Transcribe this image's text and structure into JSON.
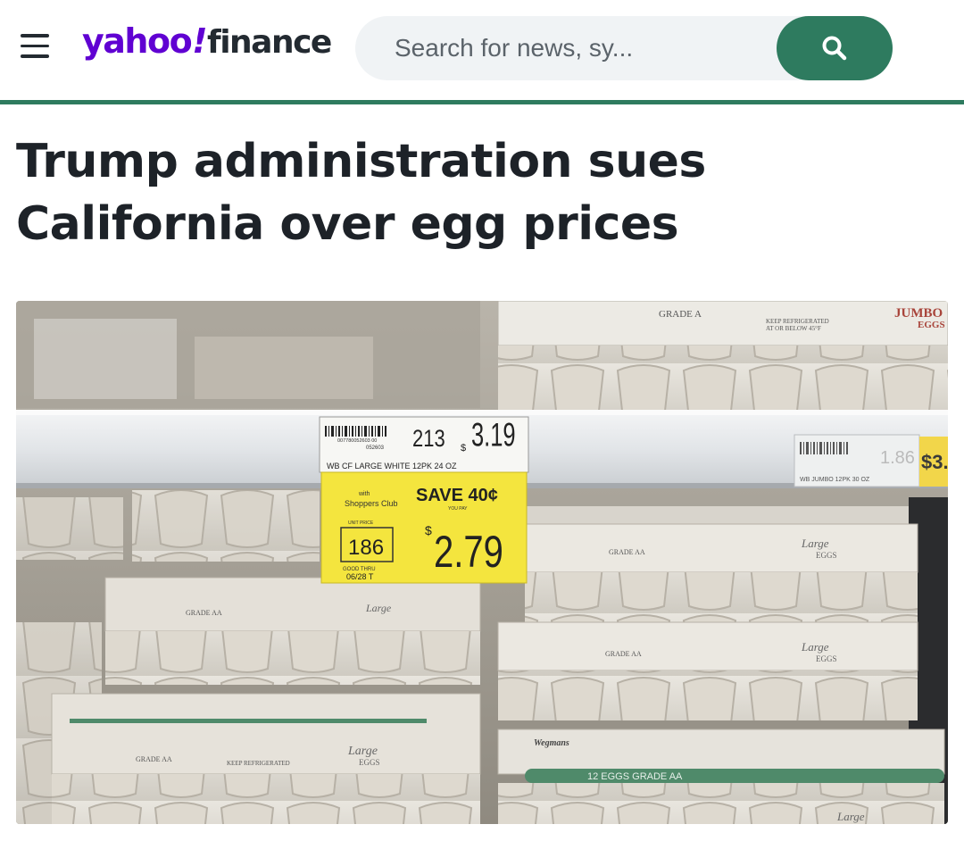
{
  "header": {
    "menu_icon": "hamburger-menu-icon",
    "logo": {
      "part1": "yahoo",
      "bang": "!",
      "part2": "finance"
    },
    "search": {
      "placeholder": "Search for news, sy...",
      "button_icon": "search-icon"
    },
    "accent_color": "#2e7b5f",
    "logo_color": "#6001d2"
  },
  "article": {
    "headline": "Trump administration sues California over egg prices",
    "image": {
      "shelf_tag": {
        "barcode_number": "007780052603 00",
        "item_code": "052603",
        "unit_price": "213",
        "price": "3.19",
        "price_cents_symbol": "$",
        "description": "WB CF LARGE WHITE 12PK 24 OZ",
        "with_label": "with",
        "club_label": "Shoppers Club",
        "unit_price_label": "UNIT PRICE",
        "club_unit_price": "186",
        "save_text": "SAVE 40¢",
        "you_pay_label": "YOU PAY",
        "club_price": "2.79",
        "good_thru_label": "GOOD THRU",
        "good_thru_date": "06/28 T"
      },
      "right_tag": {
        "desc": "WB JUMBO 12PK 30 OZ",
        "price": "1.86",
        "price2": "$3."
      },
      "carton_grade_a": "GRADE A",
      "carton_grade_aa": "GRADE AA",
      "carton_large": "Large",
      "carton_eggs": "EGGS",
      "carton_jumbo": "JUMBO",
      "carton_keep": "KEEP REFRIGERATED",
      "carton_below": "AT OR BELOW 45°F",
      "carton_brand": "Wegmans",
      "carton_count": "12 EGGS  GRADE AA"
    }
  }
}
